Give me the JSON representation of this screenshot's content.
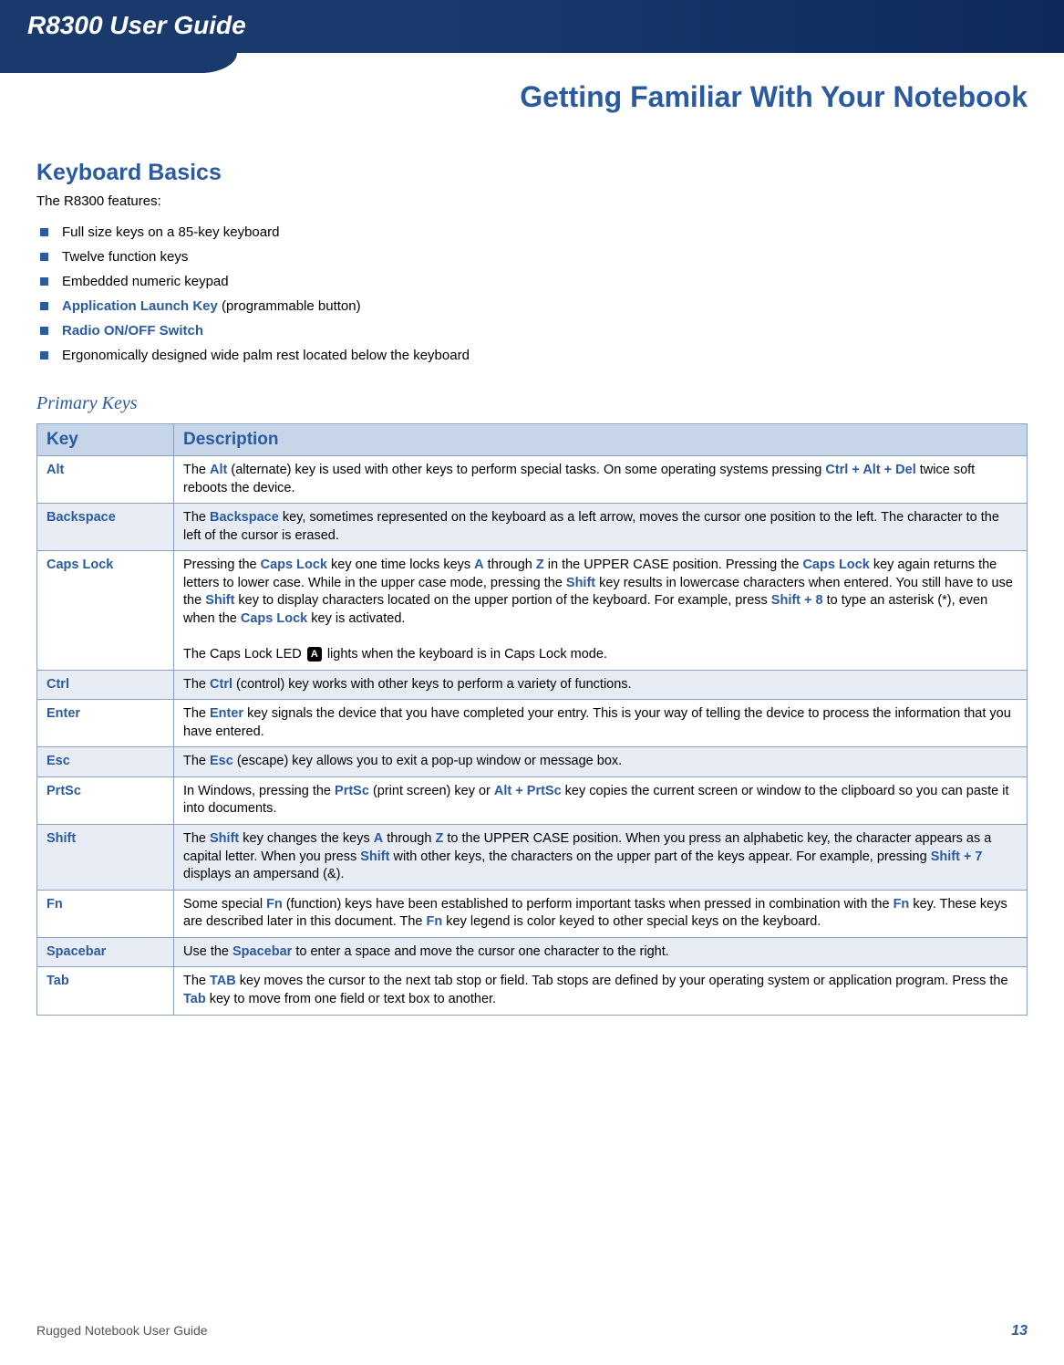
{
  "header": {
    "title": "R8300 User Guide"
  },
  "chapter": {
    "title": "Getting Familiar With Your Notebook"
  },
  "section": {
    "heading": "Keyboard Basics",
    "intro": "The R8300 features:",
    "features": [
      {
        "pre": "",
        "bold": "",
        "post": "Full size keys on a 85-key keyboard"
      },
      {
        "pre": "",
        "bold": "",
        "post": "Twelve function keys"
      },
      {
        "pre": "",
        "bold": "",
        "post": "Embedded numeric keypad"
      },
      {
        "pre": "",
        "bold": "Application Launch Key",
        "post": " (programmable button)"
      },
      {
        "pre": "",
        "bold": "Radio ON/OFF Switch",
        "post": ""
      },
      {
        "pre": "",
        "bold": "",
        "post": "Ergonomically designed wide palm rest located below the keyboard"
      }
    ],
    "subheading": "Primary Keys"
  },
  "table": {
    "head": {
      "key": "Key",
      "desc": "Description"
    },
    "rows": [
      {
        "key": "Alt",
        "segments": [
          {
            "t": "The "
          },
          {
            "t": "Alt",
            "b": true
          },
          {
            "t": " (alternate) key is used with other keys to perform special tasks. On some operating systems pressing "
          },
          {
            "t": "Ctrl + Alt + Del",
            "b": true
          },
          {
            "t": " twice soft reboots the device."
          }
        ]
      },
      {
        "key": "Backspace",
        "striped": true,
        "segments": [
          {
            "t": "The "
          },
          {
            "t": "Backspace",
            "b": true
          },
          {
            "t": " key, sometimes represented on the keyboard as a left arrow, moves the cursor one position to the left. The character to the left of the cursor is erased."
          }
        ]
      },
      {
        "key": "Caps Lock",
        "segments": [
          {
            "t": "Pressing the "
          },
          {
            "t": "Caps Lock",
            "b": true
          },
          {
            "t": " key one time locks keys "
          },
          {
            "t": "A",
            "b": true
          },
          {
            "t": " through "
          },
          {
            "t": "Z",
            "b": true
          },
          {
            "t": " in the UPPER CASE position. Pressing the "
          },
          {
            "t": "Caps Lock",
            "b": true
          },
          {
            "t": " key again returns the letters to lower case. While in the upper case mode, pressing the "
          },
          {
            "t": "Shift",
            "b": true
          },
          {
            "t": " key results in lowercase characters when entered. You still have to use the "
          },
          {
            "t": "Shift",
            "b": true
          },
          {
            "t": " key to display characters located on the upper portion of the keyboard. For example, press "
          },
          {
            "t": "Shift + 8",
            "b": true
          },
          {
            "t": " to type an asterisk (*), even when the "
          },
          {
            "t": "Caps Lock",
            "b": true
          },
          {
            "t": " key is activated."
          },
          {
            "br": true
          },
          {
            "t": "The Caps Lock LED "
          },
          {
            "icon": "A"
          },
          {
            "t": " lights when the keyboard is in Caps Lock mode."
          }
        ]
      },
      {
        "key": "Ctrl",
        "striped": true,
        "segments": [
          {
            "t": "The "
          },
          {
            "t": "Ctrl",
            "b": true
          },
          {
            "t": " (control) key works with other keys to perform a variety of functions."
          }
        ]
      },
      {
        "key": "Enter",
        "segments": [
          {
            "t": "The "
          },
          {
            "t": "Enter",
            "b": true
          },
          {
            "t": " key signals the device that you have completed your entry. This is your way of telling the device to process the information that you have entered."
          }
        ]
      },
      {
        "key": "Esc",
        "striped": true,
        "segments": [
          {
            "t": "The "
          },
          {
            "t": "Esc",
            "b": true
          },
          {
            "t": " (escape) key allows you to exit a pop-up window or message box."
          }
        ]
      },
      {
        "key": "PrtSc",
        "segments": [
          {
            "t": "In Windows, pressing the "
          },
          {
            "t": "PrtSc",
            "b": true
          },
          {
            "t": " (print screen) key or "
          },
          {
            "t": "Alt + PrtSc",
            "b": true
          },
          {
            "t": " key copies the current screen or window to the clipboard so you can paste it into documents."
          }
        ]
      },
      {
        "key": "Shift",
        "striped": true,
        "segments": [
          {
            "t": "The "
          },
          {
            "t": "Shift",
            "b": true
          },
          {
            "t": " key changes the keys "
          },
          {
            "t": "A",
            "b": true
          },
          {
            "t": " through "
          },
          {
            "t": "Z",
            "b": true
          },
          {
            "t": " to the UPPER CASE position. When you press an alphabetic key, the character appears as a capital letter. When you press "
          },
          {
            "t": "Shift",
            "b": true
          },
          {
            "t": " with other keys, the characters on the upper part of the keys appear. For example, pressing "
          },
          {
            "t": "Shift + 7",
            "b": true
          },
          {
            "t": " displays an ampersand (&)."
          }
        ]
      },
      {
        "key": "Fn",
        "segments": [
          {
            "t": "Some special "
          },
          {
            "t": "Fn",
            "b": true
          },
          {
            "t": " (function) keys have been established to perform important tasks when pressed in combination with the "
          },
          {
            "t": "Fn",
            "b": true
          },
          {
            "t": " key. These keys are described later in this document. The "
          },
          {
            "t": "Fn",
            "b": true
          },
          {
            "t": " key legend is color keyed to other special keys on the keyboard."
          }
        ]
      },
      {
        "key": "Spacebar",
        "striped": true,
        "segments": [
          {
            "t": "Use the "
          },
          {
            "t": "Spacebar",
            "b": true
          },
          {
            "t": " to enter a space and move the cursor one character to the right."
          }
        ]
      },
      {
        "key": "Tab",
        "segments": [
          {
            "t": "The "
          },
          {
            "t": "TAB",
            "b": true
          },
          {
            "t": " key moves the cursor to the next tab stop or field. Tab stops are defined by your operating system or application program. Press the "
          },
          {
            "t": "Tab",
            "b": true
          },
          {
            "t": " key to move from one field or text box to another."
          }
        ]
      }
    ]
  },
  "footer": {
    "left": "Rugged Notebook User Guide",
    "page": "13"
  }
}
